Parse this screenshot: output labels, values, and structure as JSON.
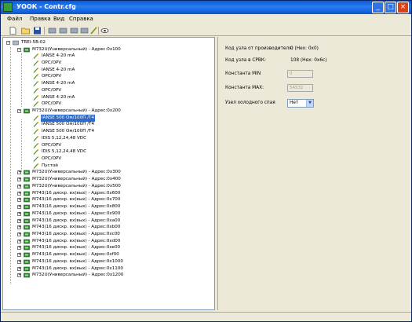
{
  "window": {
    "title": "УООК - Contr.cfg"
  },
  "menu": {
    "items": [
      "Файл",
      "Правка",
      "Вид",
      "Справка"
    ]
  },
  "toolbar": {
    "icons": [
      "new-file-icon",
      "open-folder-icon",
      "save-icon",
      "module-icon",
      "module-icon",
      "module-icon",
      "module-icon",
      "probe-icon",
      "view-icon"
    ]
  },
  "tree": {
    "root": "TREI-5B-02",
    "nodes": [
      {
        "label": "M732U(Универсальный) - Адрес:0x100",
        "kind": "module",
        "level": 1,
        "expanded": true
      },
      {
        "label": "IANSE 4-20 mA",
        "kind": "channel",
        "level": 2
      },
      {
        "label": "OPC/OPV",
        "kind": "channel",
        "level": 2
      },
      {
        "label": "IANSE 4-20 mA",
        "kind": "channel",
        "level": 2
      },
      {
        "label": "OPC/OPV",
        "kind": "channel",
        "level": 2
      },
      {
        "label": "IANSE 4-20 mA",
        "kind": "channel",
        "level": 2
      },
      {
        "label": "OPC/OPV",
        "kind": "channel",
        "level": 2
      },
      {
        "label": "IANSE 4-20 mA",
        "kind": "channel",
        "level": 2
      },
      {
        "label": "OPC/OPV",
        "kind": "channel",
        "level": 2
      },
      {
        "label": "M732U(Универсальный) - Адрес:0x200",
        "kind": "module",
        "level": 1,
        "expanded": true
      },
      {
        "label": "IANSE 500 Ом/100П /T4",
        "kind": "channel",
        "level": 2,
        "selected": true
      },
      {
        "label": "IANSE 500 Ом/100П /T4",
        "kind": "channel",
        "level": 2
      },
      {
        "label": "IANSE 500 Ом/100П /T4",
        "kind": "channel",
        "level": 2
      },
      {
        "label": "IDIS 5,12,24,48 VDC",
        "kind": "channel",
        "level": 2
      },
      {
        "label": "OPC/OPV",
        "kind": "channel",
        "level": 2
      },
      {
        "label": "IDIS 5,12,24,48 VDC",
        "kind": "channel",
        "level": 2
      },
      {
        "label": "OPC/OPV",
        "kind": "channel",
        "level": 2
      },
      {
        "label": "Пустой",
        "kind": "channel",
        "level": 2
      },
      {
        "label": "M732U(Универсальный) - Адрес:0x300",
        "kind": "module",
        "level": 1
      },
      {
        "label": "M732U(Универсальный) - Адрес:0x400",
        "kind": "module",
        "level": 1
      },
      {
        "label": "M732U(Универсальный) - Адрес:0x500",
        "kind": "module",
        "level": 1
      },
      {
        "label": "M743(16 дискр. вх(вых) - Адрес:0x600",
        "kind": "module",
        "level": 1
      },
      {
        "label": "M743(16 дискр. вх(вых) - Адрес:0x700",
        "kind": "module",
        "level": 1
      },
      {
        "label": "M743(16 дискр. вх(вых) - Адрес:0x800",
        "kind": "module",
        "level": 1
      },
      {
        "label": "M743(16 дискр. вх(вых) - Адрес:0x900",
        "kind": "module",
        "level": 1
      },
      {
        "label": "M743(16 дискр. вх(вых) - Адрес:0xa00",
        "kind": "module",
        "level": 1
      },
      {
        "label": "M743(16 дискр. вх(вых) - Адрес:0xb00",
        "kind": "module",
        "level": 1
      },
      {
        "label": "M743(16 дискр. вх(вых) - Адрес:0xc00",
        "kind": "module",
        "level": 1
      },
      {
        "label": "M743(16 дискр. вх(вых) - Адрес:0xd00",
        "kind": "module",
        "level": 1
      },
      {
        "label": "M743(16 дискр. вх(вых) - Адрес:0xe00",
        "kind": "module",
        "level": 1
      },
      {
        "label": "M743(16 дискр. вх(вых) - Адрес:0xf00",
        "kind": "module",
        "level": 1
      },
      {
        "label": "M743(16 дискр. вх(вых) - Адрес:0x1000",
        "kind": "module",
        "level": 1
      },
      {
        "label": "M743(16 дискр. вх(вых) - Адрес:0x1100",
        "kind": "module",
        "level": 1
      },
      {
        "label": "M732U(Универсальный) - Адрес:0x1200",
        "kind": "module",
        "level": 1
      }
    ]
  },
  "props": {
    "vendor_code_label": "Код узла от производителя:",
    "vendor_code_value": "0 (Hex: 0x0)",
    "srvk_code_label": "Код узла в СРВК:",
    "srvk_code_value": "108 (Hex: 0x6c)",
    "const_min_label": "Константа MIN",
    "const_min_value": "0",
    "const_max_label": "Константа MAX:",
    "const_max_value": "54532",
    "cold_junction_label": "Узел холодного спая",
    "cold_junction_value": "Нет"
  },
  "colors": {
    "title_bar": "#0a5bd8",
    "selection": "#316ac5",
    "module_icon": "#2f8f2f"
  }
}
